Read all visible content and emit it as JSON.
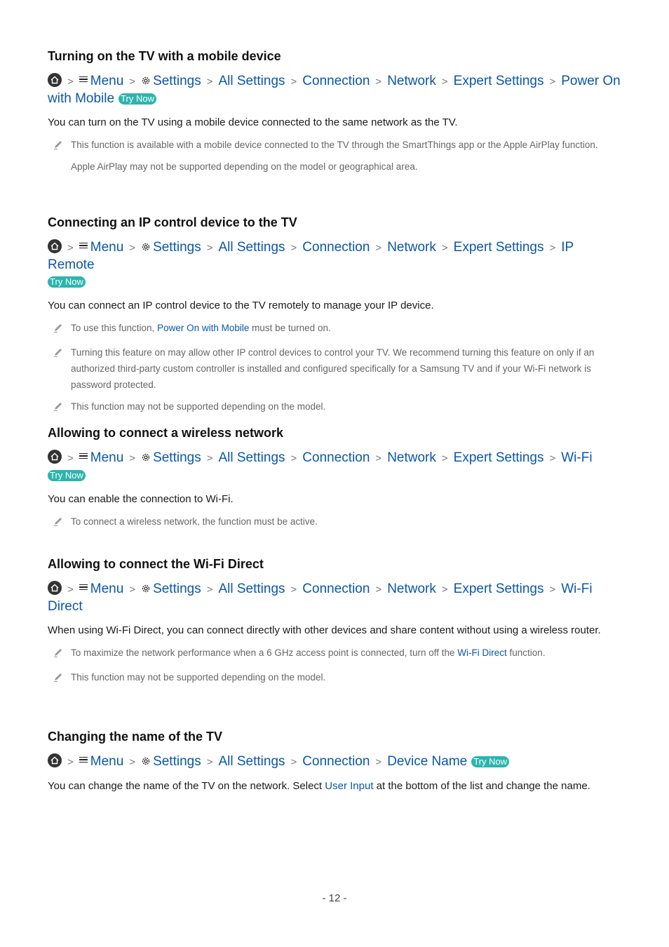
{
  "sections": [
    {
      "heading": "Turning on the TV with a mobile device",
      "path": [
        "Menu",
        "Settings",
        "All Settings",
        "Connection",
        "Network",
        "Expert Settings",
        "Power On with Mobile"
      ],
      "try_now": "Try Now",
      "body": "You can turn on the TV using a mobile device connected to the same network as the TV.",
      "notes": [
        "This function is available with a mobile device connected to the TV through the SmartThings app or the Apple AirPlay function."
      ],
      "note_cont": "Apple AirPlay may not be supported depending on the model or geographical area."
    },
    {
      "heading": "Connecting an IP control device to the TV",
      "path": [
        "Menu",
        "Settings",
        "All Settings",
        "Connection",
        "Network",
        "Expert Settings",
        "IP Remote"
      ],
      "try_now": "Try Now",
      "body": "You can connect an IP control device to the TV remotely to manage your IP device.",
      "note1_pre": "To use this function, ",
      "note1_link": "Power On with Mobile",
      "note1_post": " must be turned on.",
      "note2": "Turning this feature on may allow other IP control devices to control your TV. We recommend turning this feature on only if an authorized third-party custom controller is installed and configured specifically for a Samsung TV and if your Wi-Fi network is password protected.",
      "note3": "This function may not be supported depending on the model."
    },
    {
      "heading": "Allowing to connect a wireless network",
      "path": [
        "Menu",
        "Settings",
        "All Settings",
        "Connection",
        "Network",
        "Expert Settings",
        "Wi-Fi"
      ],
      "try_now": "Try Now",
      "body": "You can enable the connection to Wi-Fi.",
      "note1": "To connect a wireless network, the function must be active."
    },
    {
      "heading": "Allowing to connect the Wi-Fi Direct",
      "path": [
        "Menu",
        "Settings",
        "All Settings",
        "Connection",
        "Network",
        "Expert Settings",
        "Wi-Fi Direct"
      ],
      "body": "When using Wi-Fi Direct, you can connect directly with other devices and share content without using a wireless router.",
      "note1_pre": "To maximize the network performance when a 6 GHz access point is connected, turn off the ",
      "note1_link": "Wi-Fi Direct",
      "note1_post": " function.",
      "note2": "This function may not be supported depending on the model."
    },
    {
      "heading": "Changing the name of the TV",
      "path": [
        "Menu",
        "Settings",
        "All Settings",
        "Connection",
        "Device Name"
      ],
      "try_now": "Try Now",
      "body_pre": "You can change the name of the TV on the network. Select ",
      "body_link": "User Input",
      "body_post": " at the bottom of the list and change the name."
    }
  ],
  "page_number": "- 12 -"
}
